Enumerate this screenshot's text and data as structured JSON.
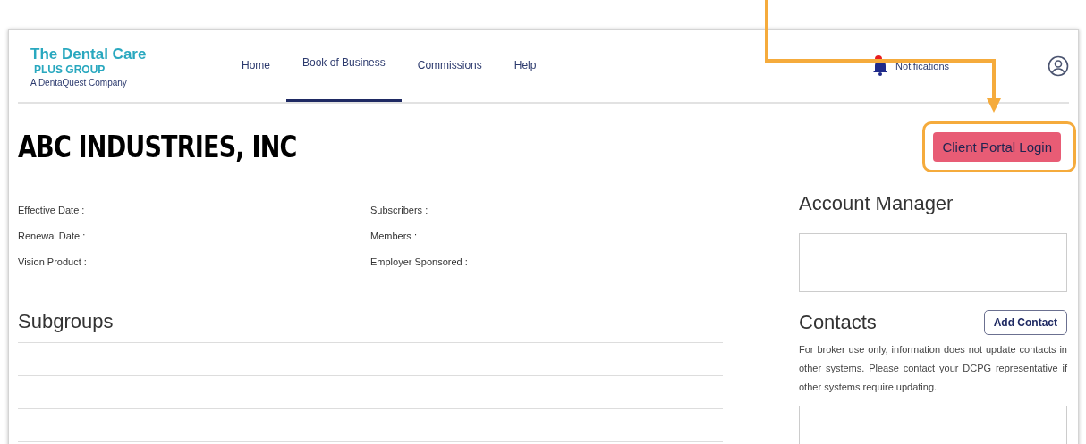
{
  "logo": {
    "title": "The Dental Care",
    "subtitle": "PLUS GROUP",
    "tagline": "A DentaQuest Company"
  },
  "nav": [
    {
      "label": "Home",
      "selected": false
    },
    {
      "label": "Book of Business",
      "selected": true
    },
    {
      "label": "Commissions",
      "selected": false
    },
    {
      "label": "Help",
      "selected": false
    }
  ],
  "notifications": {
    "label": "Notifications",
    "unread": true
  },
  "page_title": "ABC INDUSTRIES, INC",
  "client_portal_button": {
    "label": "Client Portal Login",
    "highlighted": true
  },
  "fields_left": [
    "Effective Date :",
    "Renewal Date :",
    "Vision Product :"
  ],
  "fields_right": [
    "Subscribers :",
    "Members :",
    "Employer Sponsored :"
  ],
  "subgroups": {
    "title": "Subgroups"
  },
  "account_manager": {
    "title": "Account Manager"
  },
  "contacts": {
    "title": "Contacts",
    "button": "Add Contact",
    "note": "For broker use only, information does not update contacts in other systems. Please contact your DCPG representative if other systems require updating."
  }
}
